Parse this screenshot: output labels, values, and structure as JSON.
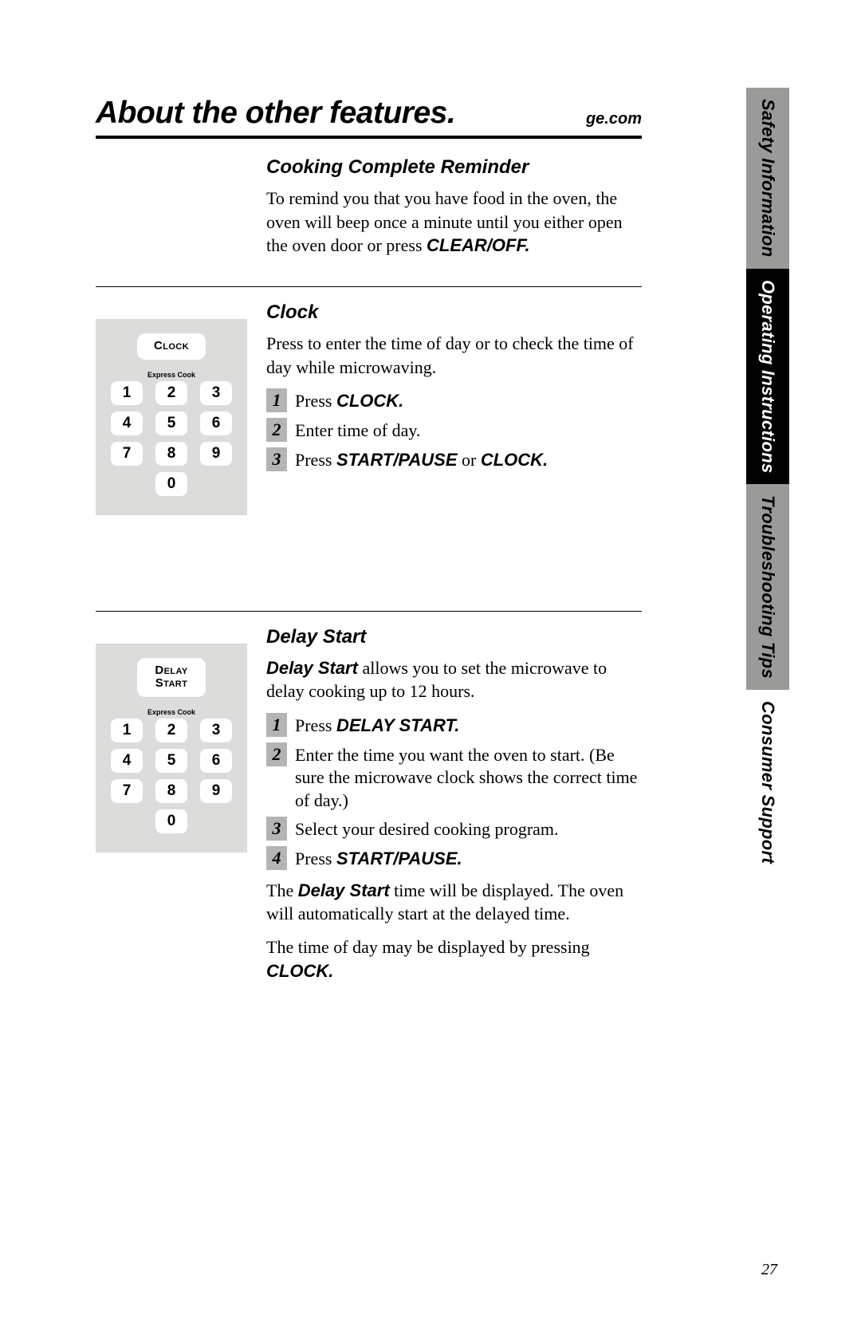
{
  "header": {
    "title": "About the other features.",
    "brand": "ge.com"
  },
  "tabs": {
    "safety": "Safety Information",
    "operating": "Operating Instructions",
    "troubleshooting": "Troubleshooting Tips",
    "consumer": "Consumer Support"
  },
  "sections": {
    "reminder": {
      "heading": "Cooking Complete Reminder",
      "body_a": "To remind you that you have food in the oven, the oven will beep once a minute until you either open the oven door or press ",
      "body_bold": "CLEAR/OFF."
    },
    "clock": {
      "heading": "Clock",
      "body": "Press to enter the time of day or to check the time of day while microwaving.",
      "illus_button": "Clock",
      "illus_express": "Express Cook",
      "steps": {
        "s1a": "Press ",
        "s1b": "CLOCK.",
        "s2": "Enter time of day.",
        "s3a": "Press ",
        "s3b": "START/PAUSE",
        "s3c": " or ",
        "s3d": "CLOCK."
      }
    },
    "delay": {
      "heading": "Delay Start",
      "body_bold": "Delay Start",
      "body_rest": " allows you to set the microwave to delay cooking up to 12 hours.",
      "illus_button_l1": "Delay",
      "illus_button_l2": "Start",
      "illus_express": "Express Cook",
      "steps": {
        "s1a": "Press ",
        "s1b": "DELAY START.",
        "s2": "Enter the time you want the oven to start. (Be sure the microwave clock shows the correct time of day.)",
        "s3": "Select your desired cooking program.",
        "s4a": "Press ",
        "s4b": "START/PAUSE."
      },
      "after1a": "The ",
      "after1b": "Delay Start",
      "after1c": " time will be displayed. The oven will automatically start at the delayed time.",
      "after2a": "The time of day may be displayed by pressing ",
      "after2b": "CLOCK."
    }
  },
  "keypad": [
    "1",
    "2",
    "3",
    "4",
    "5",
    "6",
    "7",
    "8",
    "9",
    "0"
  ],
  "step_numbers": [
    "1",
    "2",
    "3",
    "4"
  ],
  "page_number": "27"
}
